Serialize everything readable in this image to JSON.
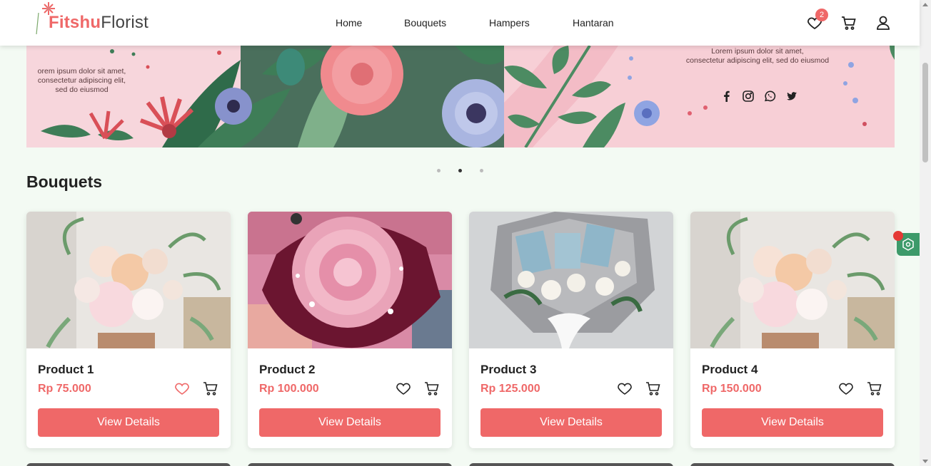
{
  "brand": {
    "name_part1": "Fitshu",
    "name_part2": "Florist"
  },
  "nav": {
    "home": "Home",
    "bouquets": "Bouquets",
    "hampers": "Hampers",
    "hantaran": "Hantaran"
  },
  "header": {
    "wishlist_count": "2"
  },
  "banner": {
    "left_text": "orem ipsum dolor sit amet,\nconsectetur adipiscing elit,\nsed do eiusmod",
    "right_text": "Lorem ipsum dolor sit amet,\nconsectetur adipiscing elit, sed do eiusmod",
    "slide_count": 3,
    "active_slide": 2
  },
  "section": {
    "title": "Bouquets"
  },
  "products": [
    {
      "name": "Product 1",
      "price": "Rp 75.000",
      "button": "View Details",
      "liked": true
    },
    {
      "name": "Product 2",
      "price": "Rp 100.000",
      "button": "View Details",
      "liked": false
    },
    {
      "name": "Product 3",
      "price": "Rp 125.000",
      "button": "View Details",
      "liked": false
    },
    {
      "name": "Product 4",
      "price": "Rp 150.000",
      "button": "View Details",
      "liked": false
    }
  ],
  "colors": {
    "accent": "#ef6868",
    "background": "#f3faf3",
    "banner_pink": "#f7d6dc",
    "widget": "#3d9a6a"
  },
  "icons": [
    "heart-icon",
    "cart-icon",
    "user-icon",
    "facebook-icon",
    "instagram-icon",
    "whatsapp-icon",
    "twitter-icon"
  ]
}
